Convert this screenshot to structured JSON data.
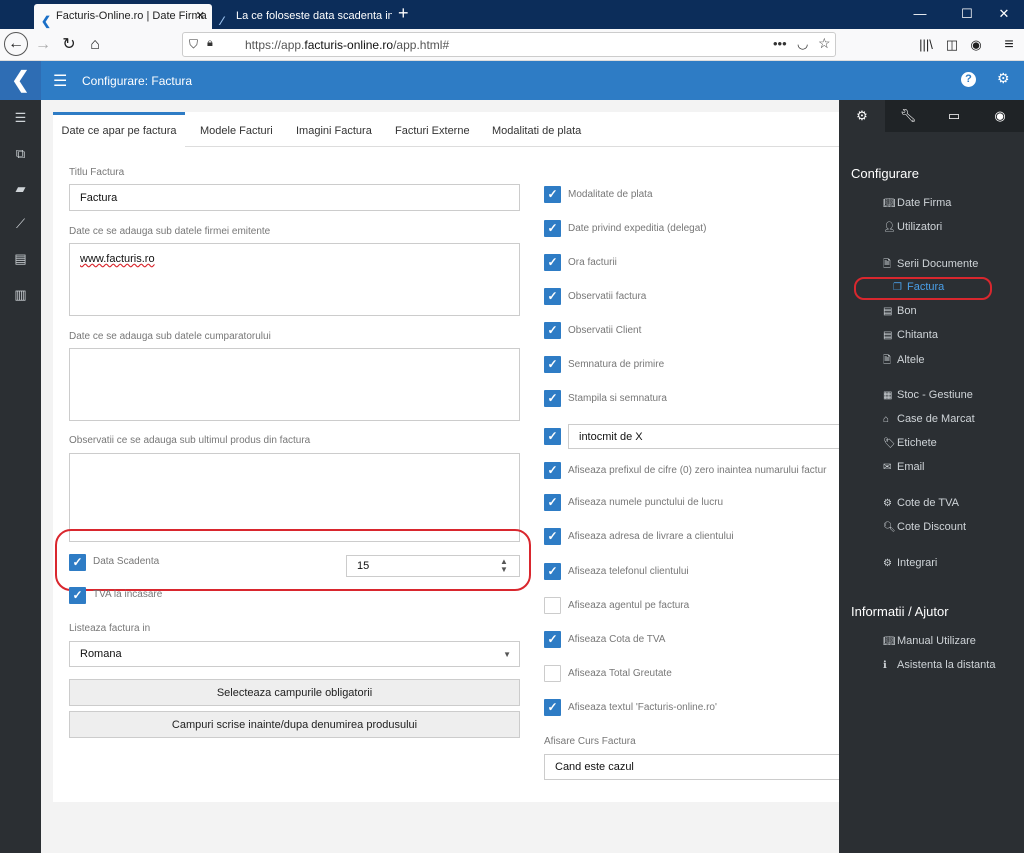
{
  "browser": {
    "tabs": [
      {
        "title": "Facturis-Online.ro | Date Firma"
      },
      {
        "title": "La ce foloseste data scadenta in"
      }
    ],
    "url_prefix": "https://app.",
    "url_domain": "facturis-online.ro",
    "url_path": "/app.html#"
  },
  "app": {
    "title": "Configurare: Factura",
    "tabs": [
      "Date ce apar pe factura",
      "Modele Facturi",
      "Imagini Factura",
      "Facturi Externe",
      "Modalitati de plata"
    ]
  },
  "form": {
    "titlu_label": "Titlu Factura",
    "titlu_value": "Factura",
    "firma_label": "Date ce se adauga sub datele firmei emitente",
    "firma_value": "www.facturis.ro",
    "cump_label": "Date ce se adauga sub datele cumparatorului",
    "cump_value": "",
    "obs_label": "Observatii ce se adauga sub ultimul produs din factura",
    "obs_value": "",
    "data_scadenta_label": "Data Scadenta",
    "data_scadenta_value": "15",
    "tva_label": "TVA la incasare",
    "listeaza_label": "Listeaza factura in",
    "listeaza_value": "Romana",
    "btn_oblig": "Selecteaza campurile obligatorii",
    "btn_campuri": "Campuri scrise inainte/dupa denumirea produsului"
  },
  "options": [
    {
      "label": "Modalitate de plata",
      "checked": true
    },
    {
      "label": "Date privind expeditia (delegat)",
      "checked": true
    },
    {
      "label": "Ora facturii",
      "checked": true
    },
    {
      "label": "Observatii factura",
      "checked": true
    },
    {
      "label": "Observatii Client",
      "checked": true
    },
    {
      "label": "Semnatura de primire",
      "checked": true
    },
    {
      "label": "Stampila si semnatura",
      "checked": true
    },
    {
      "label": "intocmit de X",
      "checked": true
    },
    {
      "label": "Afiseaza prefixul de cifre (0) zero inaintea numarului factur",
      "checked": true
    },
    {
      "label": "Afiseaza numele punctului de lucru",
      "checked": true
    },
    {
      "label": "Afiseaza adresa de livrare a clientului",
      "checked": true
    },
    {
      "label": "Afiseaza telefonul clientului",
      "checked": true
    },
    {
      "label": "Afiseaza agentul pe factura",
      "checked": false
    },
    {
      "label": "Afiseaza Cota de TVA",
      "checked": true
    },
    {
      "label": "Afiseaza Total Greutate",
      "checked": false
    },
    {
      "label": "Afiseaza textul 'Facturis-online.ro'",
      "checked": true
    }
  ],
  "curs": {
    "label": "Afisare Curs Factura",
    "value": "Cand este cazul"
  },
  "right_panel": {
    "heading1": "Configurare",
    "items": [
      "Date Firma",
      "Utilizatori",
      "Serii Documente",
      "Factura",
      "Bon",
      "Chitanta",
      "Altele",
      "Stoc - Gestiune",
      "Case de Marcat",
      "Etichete",
      "Email",
      "Cote de TVA",
      "Cote Discount",
      "Integrari"
    ],
    "heading2": "Informatii / Ajutor",
    "items2": [
      "Manual Utilizare",
      "Asistenta la distanta"
    ]
  },
  "colors": {
    "accent": "#2e7cc5",
    "dark": "#2b2f33",
    "highlight": "#d9272e"
  }
}
